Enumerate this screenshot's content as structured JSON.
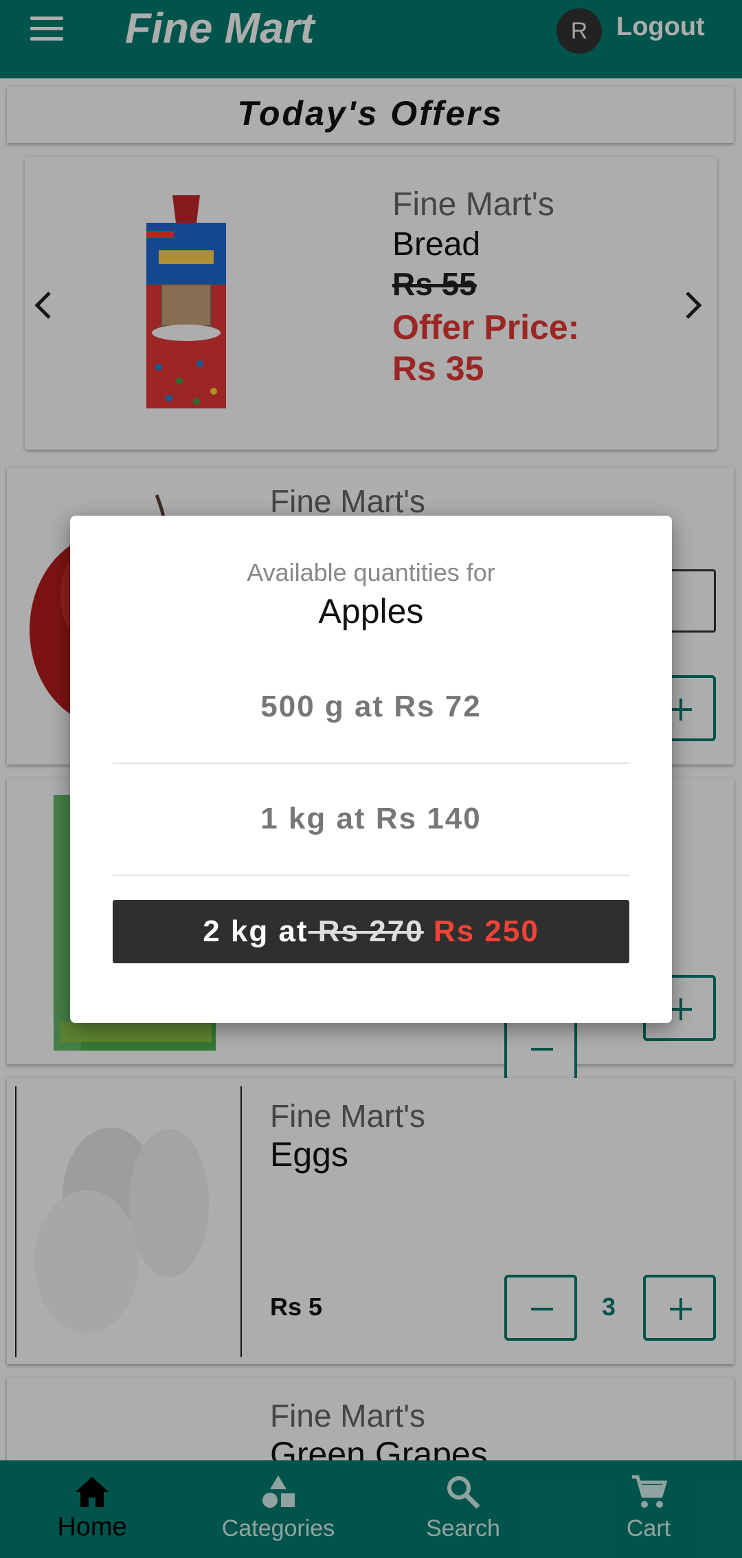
{
  "header": {
    "title": "Fine Mart",
    "avatar_initial": "R",
    "logout_label": "Logout",
    "color": "#017d6f"
  },
  "offers": {
    "heading": "Today's Offers",
    "current": {
      "brand": "Fine Mart's",
      "name": "Bread",
      "old_price": "Rs 55",
      "offer_price": "Offer Price: Rs 35"
    }
  },
  "products": [
    {
      "brand": "Fine Mart's",
      "name": "Apples"
    },
    {
      "brand": "",
      "name": ""
    },
    {
      "brand": "Fine Mart's",
      "name": "Eggs",
      "price": "Rs 5",
      "quantity": "3"
    },
    {
      "brand": "Fine Mart's",
      "name": "Green Grapes"
    }
  ],
  "dialog": {
    "subtitle": "Available quantities for",
    "title": "Apples",
    "options": [
      {
        "label": "500 g at Rs 72"
      },
      {
        "label": "1 kg at Rs 140"
      },
      {
        "prefix": "2 kg at",
        "old_price": " Rs 270",
        "new_price": " Rs 250",
        "selected": true
      }
    ]
  },
  "bottom_nav": [
    {
      "label": "Home",
      "icon": "home-icon",
      "active": true
    },
    {
      "label": "Categories",
      "icon": "categories-icon"
    },
    {
      "label": "Search",
      "icon": "search-icon"
    },
    {
      "label": "Cart",
      "icon": "cart-icon"
    }
  ]
}
